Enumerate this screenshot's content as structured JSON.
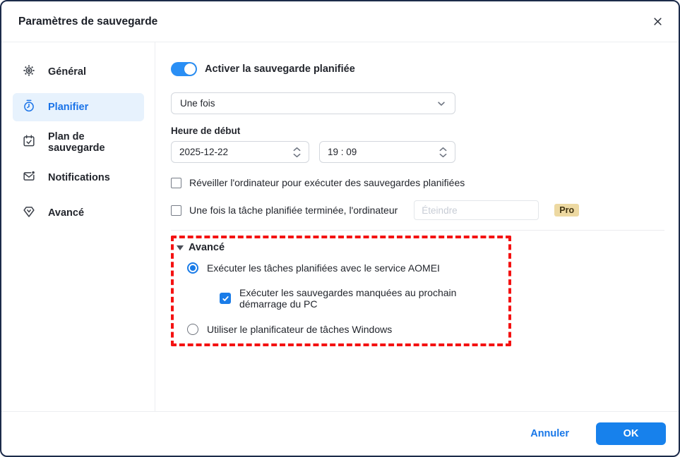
{
  "window": {
    "title": "Paramètres de sauvegarde"
  },
  "sidebar": {
    "items": [
      {
        "label": "Général",
        "icon": "gear-icon",
        "selected": false
      },
      {
        "label": "Planifier",
        "icon": "stopwatch-icon",
        "selected": true
      },
      {
        "label": "Plan de sauvegarde",
        "icon": "calendar-check-icon",
        "selected": false
      },
      {
        "label": "Notifications",
        "icon": "mail-dot-icon",
        "selected": false
      },
      {
        "label": "Avancé",
        "icon": "gem-icon",
        "selected": false
      }
    ]
  },
  "main": {
    "toggle": {
      "label": "Activer la sauvegarde planifiée",
      "state": "on"
    },
    "frequency_select": {
      "value": "Une fois"
    },
    "start_time": {
      "label": "Heure de début",
      "date_value": "2025-12-22",
      "time_value": "19 : 09"
    },
    "wake_checkbox": {
      "label": "Réveiller l'ordinateur pour exécuter des sauvegardes planifiées",
      "checked": false
    },
    "after_task": {
      "label": "Une fois la tâche planifiée terminée, l'ordinateur",
      "checked": false,
      "action_placeholder": "Éteindre",
      "badge": "Pro"
    },
    "advanced": {
      "header": "Avancé",
      "options": [
        {
          "type": "radio",
          "label": "Exécuter les tâches planifiées avec le service AOMEI",
          "selected": true
        },
        {
          "type": "checkbox",
          "label": "Exécuter les sauvegardes manquées au prochain démarrage du PC",
          "checked": true
        },
        {
          "type": "radio",
          "label": "Utiliser le planificateur de tâches Windows",
          "selected": false
        }
      ]
    }
  },
  "footer": {
    "cancel_label": "Annuler",
    "ok_label": "OK"
  },
  "colors": {
    "accent_blue": "#1a7ce8",
    "toggle_blue": "#2a8ff5",
    "ok_button_blue": "#1781ec",
    "selected_item_bg": "#e7f2fd",
    "annotation_red": "#f41212",
    "pro_badge_bg": "#edd9a2",
    "window_border": "#1c2b4a"
  }
}
